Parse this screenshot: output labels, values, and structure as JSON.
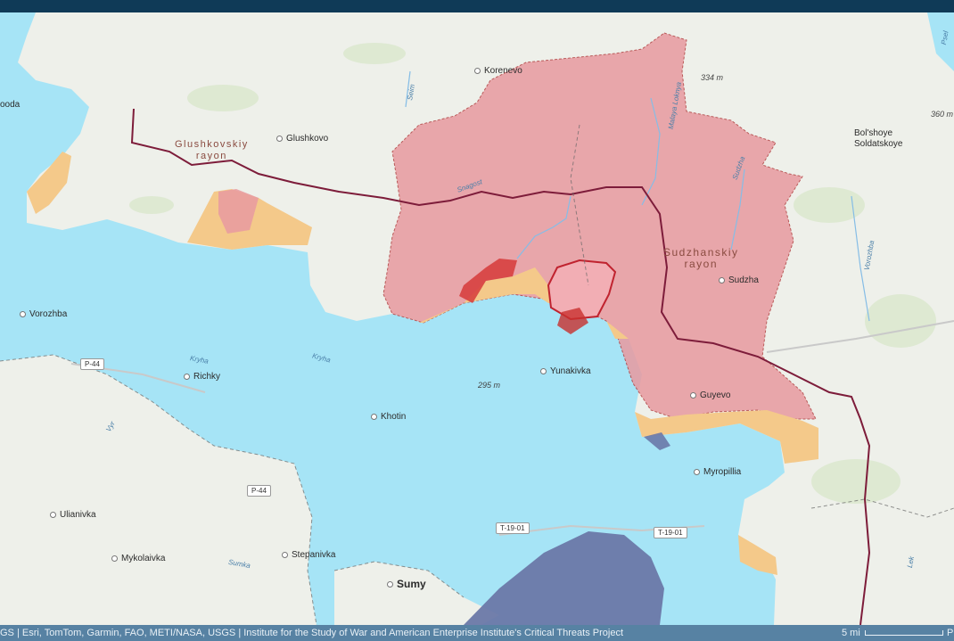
{
  "map": {
    "places": [
      {
        "id": "korenevo",
        "label": "Korenevo"
      },
      {
        "id": "glushkovo",
        "label": "Glushkovo"
      },
      {
        "id": "bolshoye",
        "label": "Bol'shoye\nSoldatskoye"
      },
      {
        "id": "sudzha",
        "label": "Sudzha"
      },
      {
        "id": "guyevo",
        "label": "Guyevo"
      },
      {
        "id": "yunakivka",
        "label": "Yunakivka"
      },
      {
        "id": "vorozhba",
        "label": "Vorozhba"
      },
      {
        "id": "richky",
        "label": "Richky"
      },
      {
        "id": "khotin",
        "label": "Khotin"
      },
      {
        "id": "myropillia",
        "label": "Myropillia"
      },
      {
        "id": "ulianivka",
        "label": "Ulianivka"
      },
      {
        "id": "mykolaivka",
        "label": "Mykolaivka"
      },
      {
        "id": "stepanivka",
        "label": "Stepanivka"
      },
      {
        "id": "sumy",
        "label": "Sumy"
      },
      {
        "id": "ooda",
        "label": "ooda"
      }
    ],
    "districts": {
      "glushkovsky": "Glushkovskiy\nrayon",
      "sudzhansky": "Sudzhanskiy\nrayon"
    },
    "rivers": {
      "seim": "Seim",
      "snagost": "Snagost",
      "malaya_loknya": "Malaya Loknya",
      "sudzha_river": "Sudzha",
      "kryha1": "Kryha",
      "kryha2": "Kryha",
      "vorozhba_river": "Vorozhba",
      "syr": "Vyr",
      "sumka": "Sumka",
      "psel": "Psel",
      "lek": "Lek"
    },
    "elevations": {
      "e334": "334 m",
      "e360": "360 m",
      "e295": "295 m"
    },
    "roads": {
      "p44_top": "P-44",
      "p44_left": "P-44",
      "t1901_a": "T-19-01",
      "t1901_b": "T-19-01"
    },
    "colors": {
      "ukraine_fill": "#a6e4f6",
      "russian_land": "#eef0ea",
      "ukrainian_advance": "#e89aa0",
      "claimed": "#f4c98a",
      "russian_counter": "#d63a3a",
      "border": "#7d1c3a",
      "front": "#6a78a8"
    }
  },
  "attribution": {
    "text": "GS | Esri, TomTom, Garmin, FAO, METI/NASA, USGS | Institute for the Study of War and American Enterprise Institute's Critical Threats Project",
    "scale": "5 mi",
    "powered": "P"
  }
}
